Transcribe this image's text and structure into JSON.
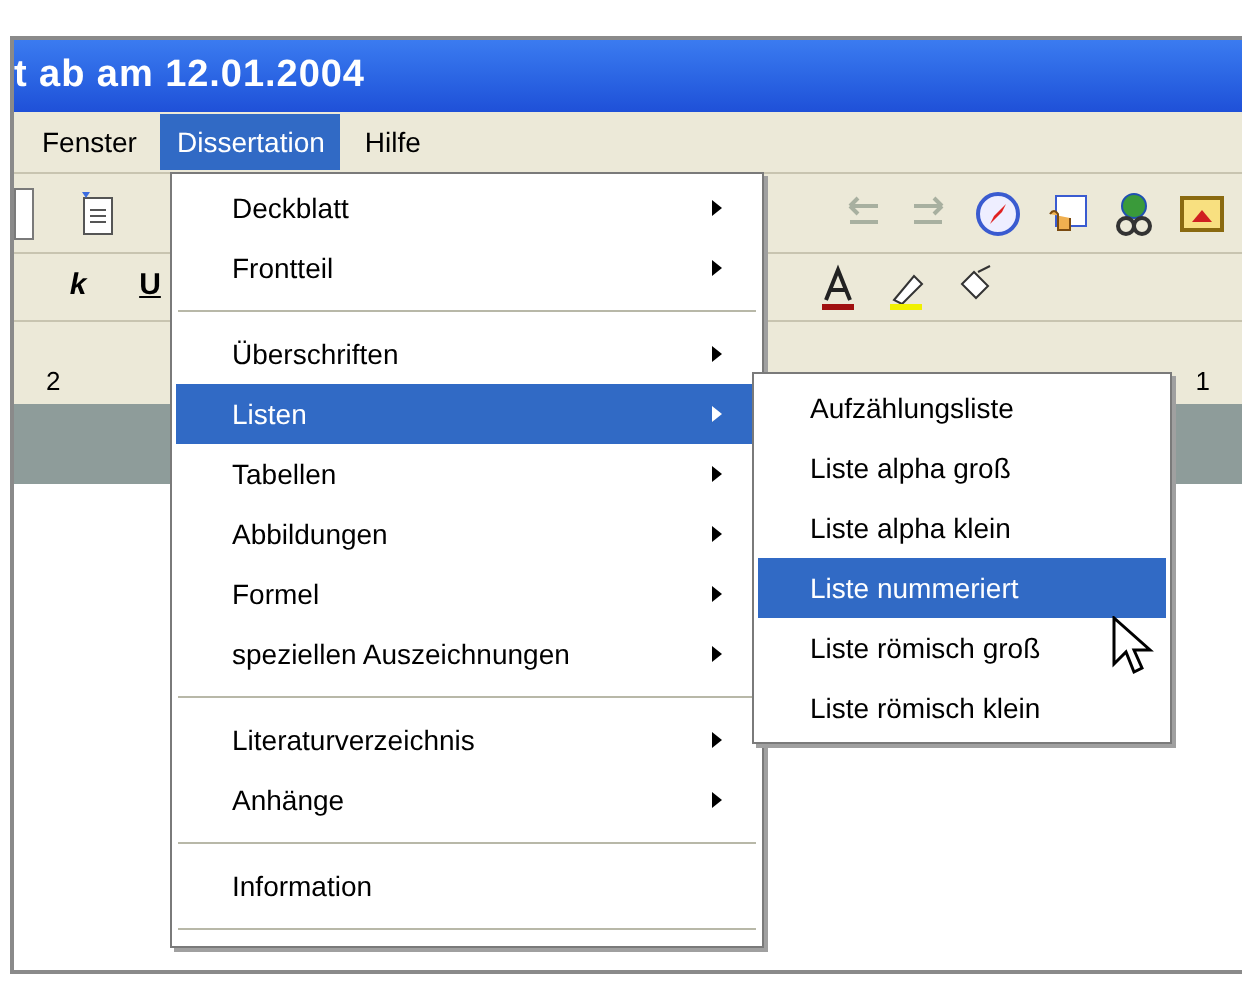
{
  "window": {
    "title": "t ab am 12.01.2004"
  },
  "menubar": [
    {
      "label": "Fenster",
      "selected": false
    },
    {
      "label": "Dissertation",
      "selected": true
    },
    {
      "label": "Hilfe",
      "selected": false
    }
  ],
  "format_toolbar": {
    "italic": "k",
    "underline": "U"
  },
  "ruler": {
    "left_mark": "2",
    "right_mark": "1"
  },
  "dropdown": [
    {
      "kind": "item",
      "label": "Deckblatt",
      "submenu": true,
      "selected": false
    },
    {
      "kind": "item",
      "label": "Frontteil",
      "submenu": true,
      "selected": false
    },
    {
      "kind": "separator"
    },
    {
      "kind": "item",
      "label": "Überschriften",
      "submenu": true,
      "selected": false
    },
    {
      "kind": "item",
      "label": "Listen",
      "submenu": true,
      "selected": true
    },
    {
      "kind": "item",
      "label": "Tabellen",
      "submenu": true,
      "selected": false
    },
    {
      "kind": "item",
      "label": "Abbildungen",
      "submenu": true,
      "selected": false
    },
    {
      "kind": "item",
      "label": "Formel",
      "submenu": true,
      "selected": false
    },
    {
      "kind": "item",
      "label": "speziellen Auszeichnungen",
      "submenu": true,
      "selected": false
    },
    {
      "kind": "separator"
    },
    {
      "kind": "item",
      "label": "Literaturverzeichnis",
      "submenu": true,
      "selected": false
    },
    {
      "kind": "item",
      "label": "Anhänge",
      "submenu": true,
      "selected": false
    },
    {
      "kind": "separator"
    },
    {
      "kind": "item",
      "label": "Information",
      "submenu": false,
      "selected": false
    },
    {
      "kind": "separator"
    }
  ],
  "submenu": [
    {
      "label": "Aufzählungsliste",
      "selected": false
    },
    {
      "label": "Liste alpha groß",
      "selected": false
    },
    {
      "label": "Liste alpha klein",
      "selected": false
    },
    {
      "label": "Liste nummeriert",
      "selected": true
    },
    {
      "label": "Liste römisch groß",
      "selected": false
    },
    {
      "label": "Liste römisch klein",
      "selected": false
    }
  ]
}
